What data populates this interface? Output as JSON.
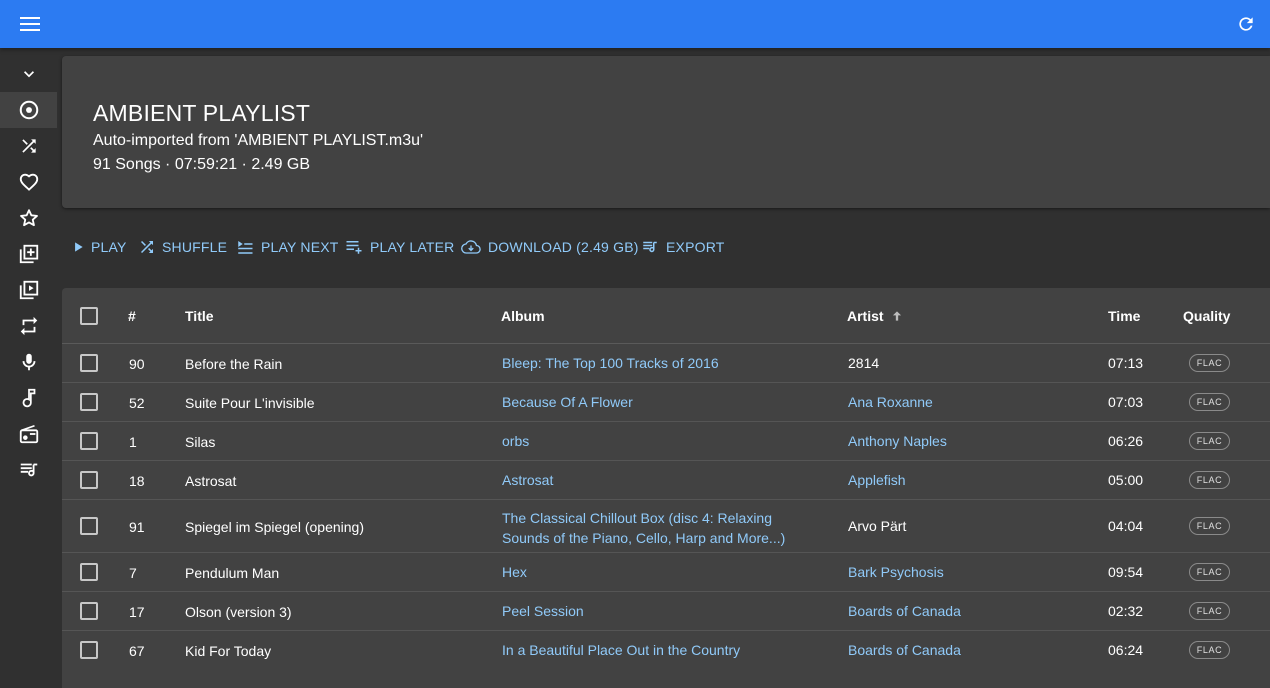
{
  "appbar": {
    "menu_icon": "menu-icon",
    "refresh_icon": "refresh-icon",
    "color": "#2c7bf2"
  },
  "sidebar": {
    "items": [
      {
        "name": "chevron-down-icon"
      },
      {
        "name": "album-icon",
        "active": true
      },
      {
        "name": "shuffle-icon"
      },
      {
        "name": "heart-icon"
      },
      {
        "name": "star-icon"
      },
      {
        "name": "library-add-icon"
      },
      {
        "name": "video-library-icon"
      },
      {
        "name": "repeat-icon"
      },
      {
        "name": "microphone-icon"
      },
      {
        "name": "music-note-icon"
      },
      {
        "name": "radio-icon"
      },
      {
        "name": "queue-music-icon"
      }
    ]
  },
  "playlist": {
    "title": "AMBIENT PLAYLIST",
    "comment": "Auto-imported from 'AMBIENT PLAYLIST.m3u'",
    "stats": "91 Songs · 07:59:21 · 2.49 GB"
  },
  "actions": {
    "play": "PLAY",
    "shuffle": "SHUFFLE",
    "play_next": "PLAY NEXT",
    "play_later": "PLAY LATER",
    "download": "DOWNLOAD (2.49 GB)",
    "export": "EXPORT"
  },
  "table": {
    "headers": {
      "num": "#",
      "title": "Title",
      "album": "Album",
      "artist": "Artist",
      "time": "Time",
      "quality": "Quality"
    },
    "sort": {
      "column": "Artist",
      "direction": "ascending"
    },
    "rows": [
      {
        "num": "90",
        "title": "Before the Rain",
        "album": "Bleep: The Top 100 Tracks of 2016",
        "album_line2": "",
        "artist": "2814",
        "artist_link": false,
        "time": "07:13",
        "quality": "FLAC"
      },
      {
        "num": "52",
        "title": "Suite Pour L'invisible",
        "album": "Because Of A Flower",
        "album_line2": "",
        "artist": "Ana Roxanne",
        "artist_link": true,
        "time": "07:03",
        "quality": "FLAC"
      },
      {
        "num": "1",
        "title": "Silas",
        "album": "orbs",
        "album_line2": "",
        "artist": "Anthony Naples",
        "artist_link": true,
        "time": "06:26",
        "quality": "FLAC"
      },
      {
        "num": "18",
        "title": "Astrosat",
        "album": "Astrosat",
        "album_line2": "",
        "artist": "Applefish",
        "artist_link": true,
        "time": "05:00",
        "quality": "FLAC"
      },
      {
        "num": "91",
        "title": "Spiegel im Spiegel (opening)",
        "album": "The Classical Chillout Box (disc 4: Relaxing",
        "album_line2": "Sounds of the Piano, Cello, Harp and More...)",
        "artist": "Arvo Pärt",
        "artist_link": false,
        "time": "04:04",
        "quality": "FLAC"
      },
      {
        "num": "7",
        "title": "Pendulum Man",
        "album": "Hex",
        "album_line2": "",
        "artist": "Bark Psychosis",
        "artist_link": true,
        "time": "09:54",
        "quality": "FLAC"
      },
      {
        "num": "17",
        "title": "Olson (version 3)",
        "album": "Peel Session",
        "album_line2": "",
        "artist": "Boards of Canada",
        "artist_link": true,
        "time": "02:32",
        "quality": "FLAC"
      },
      {
        "num": "67",
        "title": "Kid For Today",
        "album": "In a Beautiful Place Out in the Country",
        "album_line2": "",
        "artist": "Boards of Canada",
        "artist_link": true,
        "time": "06:24",
        "quality": "FLAC"
      }
    ]
  }
}
